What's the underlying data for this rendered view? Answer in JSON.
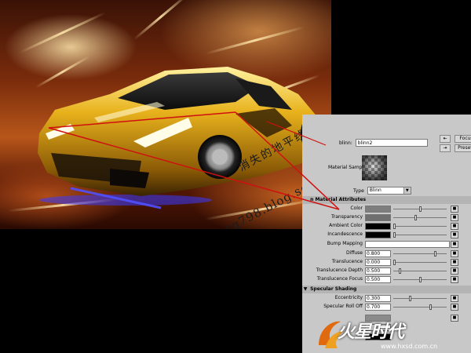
{
  "watermark": {
    "line1": "消失的地平线",
    "line2": "cg798.blog.sohu.com"
  },
  "editor": {
    "material_label": "blinn:",
    "material_name": "blinn2",
    "focus_label": "Focus",
    "presets_label": "Presets",
    "material_sample_label": "Material Sample",
    "type_label": "Type",
    "type_value": "Blinn",
    "common_section": "n Material Attributes",
    "specular_section": "Specular Shading",
    "common_attrs": [
      {
        "label": "Color",
        "swatch": "#7d7d7d",
        "level": 0.5
      },
      {
        "label": "Transparency",
        "swatch": "#6f6f6f",
        "level": 0.42
      },
      {
        "label": "Ambient Color",
        "swatch": "#000000",
        "level": 0.0
      },
      {
        "label": "Incandescence",
        "swatch": "#000000",
        "level": 0.0
      }
    ],
    "bump_label": "Bump Mapping",
    "numeric_attrs": [
      {
        "label": "Diffuse",
        "value": "0.800",
        "level": 0.8
      },
      {
        "label": "Translucence",
        "value": "0.000",
        "level": 0.0
      },
      {
        "label": "Translucence Depth",
        "value": "0.500",
        "level": 0.1
      },
      {
        "label": "Translucence Focus",
        "value": "0.500",
        "level": 0.5
      }
    ],
    "specular_attrs": [
      {
        "label": "Eccentricity",
        "value": "0.300",
        "level": 0.3
      },
      {
        "label": "Specular Roll Off",
        "value": "0.700",
        "level": 0.7
      }
    ]
  },
  "logo": {
    "text": "火星时代",
    "url": "www.hxsd.com.cn"
  },
  "colors": {
    "car_body": "#e8b21c",
    "underglow": "#3a3aff",
    "pointer_line": "#d01010",
    "panel_bg": "#c8c8c8"
  }
}
